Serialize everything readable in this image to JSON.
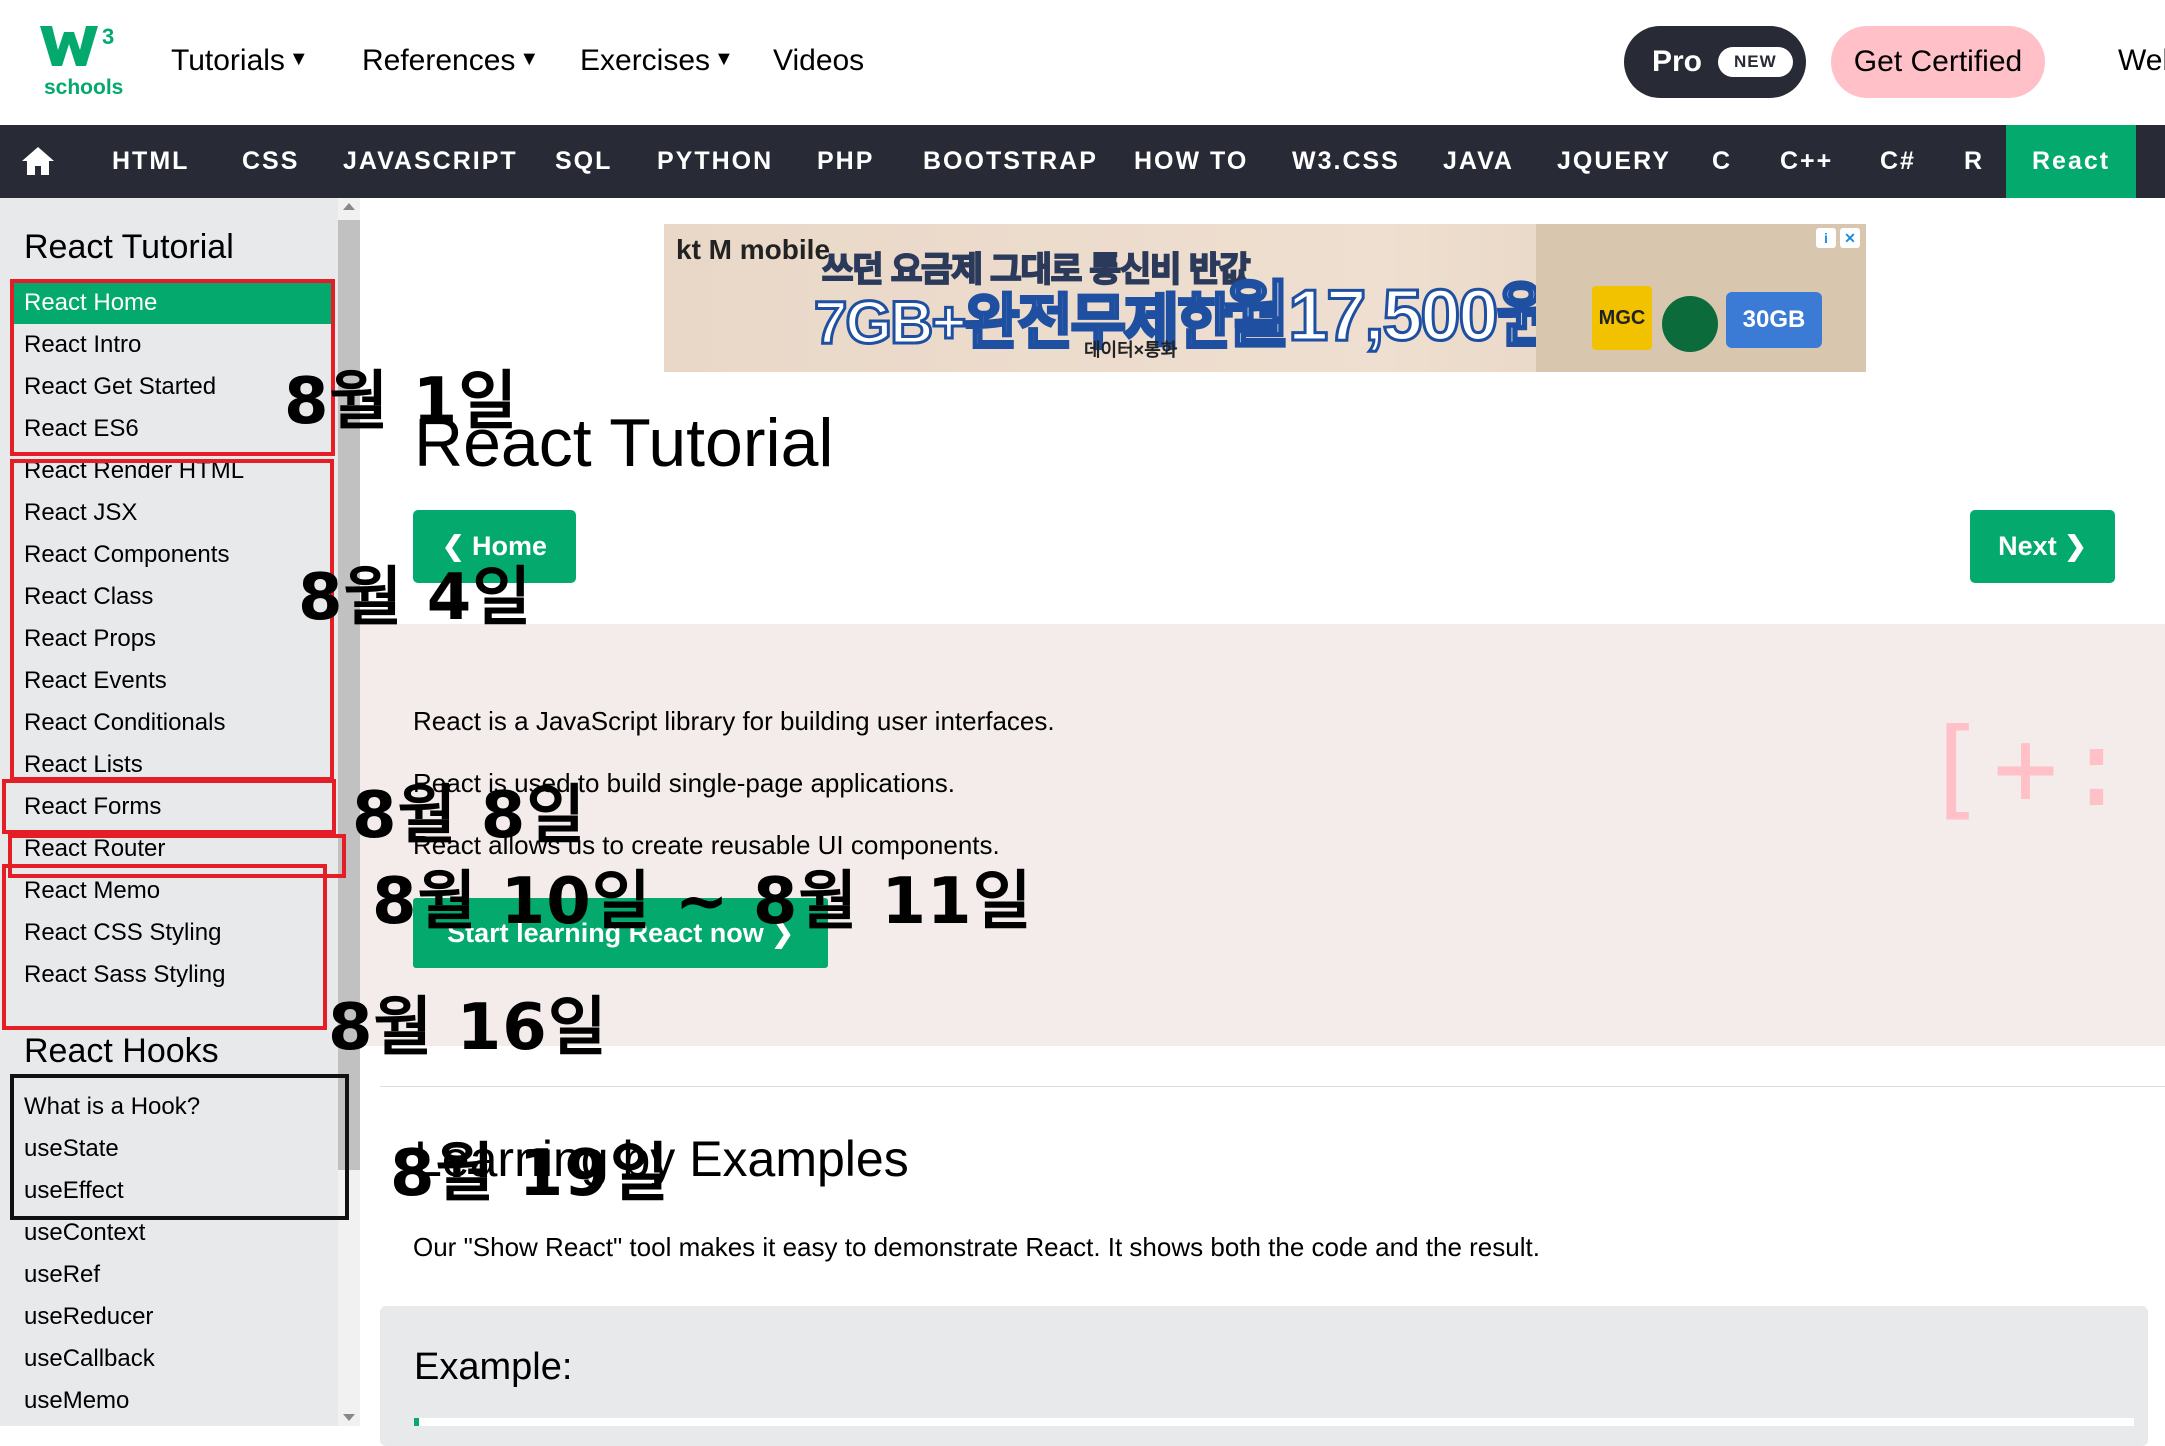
{
  "header": {
    "logo_text": "schools",
    "logo_sup": "3",
    "nav": [
      {
        "label": "Tutorials",
        "caret": true
      },
      {
        "label": "References",
        "caret": true
      },
      {
        "label": "Exercises",
        "caret": true
      },
      {
        "label": "Videos",
        "caret": false
      }
    ],
    "pro_label": "Pro",
    "pro_badge": "NEW",
    "certified_label": "Get Certified",
    "cut_label": "Web"
  },
  "topnav": [
    "HTML",
    "CSS",
    "JAVASCRIPT",
    "SQL",
    "PYTHON",
    "PHP",
    "BOOTSTRAP",
    "HOW TO",
    "W3.CSS",
    "JAVA",
    "JQUERY",
    "C",
    "C++",
    "C#",
    "R",
    "React"
  ],
  "sidebar": {
    "section1_title": "React Tutorial",
    "section1_items": [
      "React Home",
      "React Intro",
      "React Get Started",
      "React ES6",
      "React Render HTML",
      "React JSX",
      "React Components",
      "React Class",
      "React Props",
      "React Events",
      "React Conditionals",
      "React Lists",
      "React Forms",
      "React Router",
      "React Memo",
      "React CSS Styling",
      "React Sass Styling"
    ],
    "section2_title": "React Hooks",
    "section2_items": [
      "What is a Hook?",
      "useState",
      "useEffect",
      "useContext",
      "useRef",
      "useReducer",
      "useCallback",
      "useMemo"
    ]
  },
  "ad": {
    "brand": "kt M mobile",
    "line1": "쓰던 요금제 그대로 통신비 반값",
    "line2": "7GB+완전무제한",
    "sub": "데이터×통화",
    "price": "월17,500원",
    "coupon": "30GB",
    "mg": "MGC"
  },
  "main": {
    "title": "React Tutorial",
    "prev_label": "❮ Home",
    "next_label": "Next ❯",
    "hero_lines": [
      "React is a JavaScript library for building user interfaces.",
      "React is used to build single-page applications.",
      "React allows us to create reusable UI components."
    ],
    "hero_button": "Start learning React now ❯",
    "hero_deco": "[+:",
    "section2_title": "Learning by Examples",
    "section2_text": "Our \"Show React\" tool makes it easy to demonstrate React. It shows both the code and the result.",
    "example_title": "Example:"
  },
  "annotations": {
    "note1": "8월 1일",
    "note2": "8월 4일",
    "note3": "8월 8일",
    "note4": "8월 10일 ~ 8월 11일",
    "note5": "8월 16일",
    "note6": "8월 19일"
  },
  "colors": {
    "accent": "#04AA6D",
    "dark": "#282A35",
    "pink": "#FFC0C7",
    "annotation_red": "#E41E26"
  }
}
